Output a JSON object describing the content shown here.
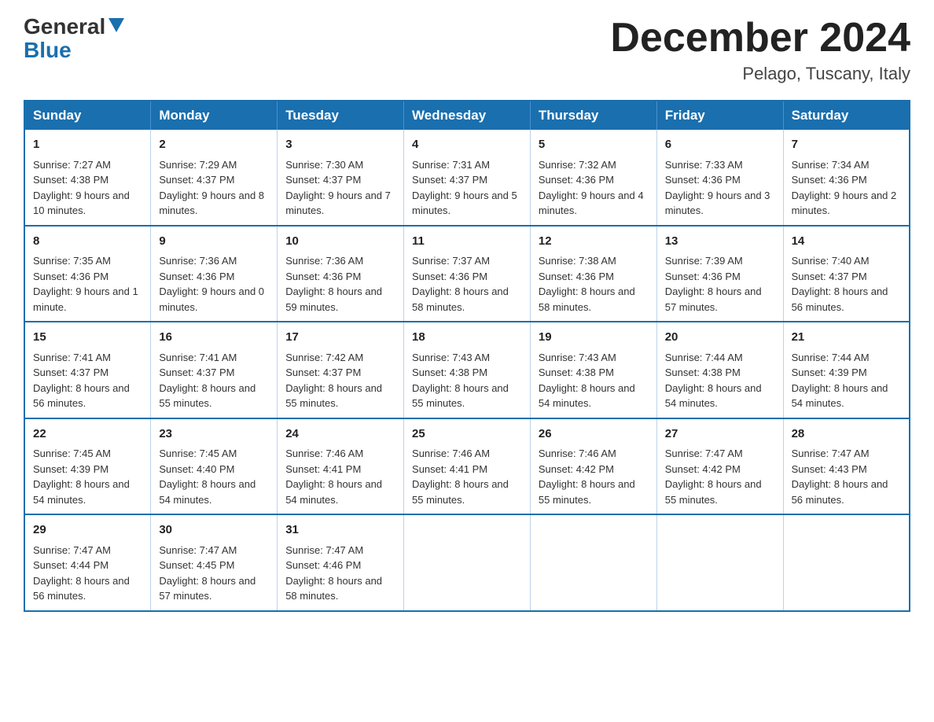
{
  "header": {
    "logo_line1": "General",
    "logo_line2": "Blue",
    "month": "December 2024",
    "location": "Pelago, Tuscany, Italy"
  },
  "days_of_week": [
    "Sunday",
    "Monday",
    "Tuesday",
    "Wednesday",
    "Thursday",
    "Friday",
    "Saturday"
  ],
  "weeks": [
    [
      {
        "day": "1",
        "sunrise": "7:27 AM",
        "sunset": "4:38 PM",
        "daylight": "9 hours and 10 minutes."
      },
      {
        "day": "2",
        "sunrise": "7:29 AM",
        "sunset": "4:37 PM",
        "daylight": "9 hours and 8 minutes."
      },
      {
        "day": "3",
        "sunrise": "7:30 AM",
        "sunset": "4:37 PM",
        "daylight": "9 hours and 7 minutes."
      },
      {
        "day": "4",
        "sunrise": "7:31 AM",
        "sunset": "4:37 PM",
        "daylight": "9 hours and 5 minutes."
      },
      {
        "day": "5",
        "sunrise": "7:32 AM",
        "sunset": "4:36 PM",
        "daylight": "9 hours and 4 minutes."
      },
      {
        "day": "6",
        "sunrise": "7:33 AM",
        "sunset": "4:36 PM",
        "daylight": "9 hours and 3 minutes."
      },
      {
        "day": "7",
        "sunrise": "7:34 AM",
        "sunset": "4:36 PM",
        "daylight": "9 hours and 2 minutes."
      }
    ],
    [
      {
        "day": "8",
        "sunrise": "7:35 AM",
        "sunset": "4:36 PM",
        "daylight": "9 hours and 1 minute."
      },
      {
        "day": "9",
        "sunrise": "7:36 AM",
        "sunset": "4:36 PM",
        "daylight": "9 hours and 0 minutes."
      },
      {
        "day": "10",
        "sunrise": "7:36 AM",
        "sunset": "4:36 PM",
        "daylight": "8 hours and 59 minutes."
      },
      {
        "day": "11",
        "sunrise": "7:37 AM",
        "sunset": "4:36 PM",
        "daylight": "8 hours and 58 minutes."
      },
      {
        "day": "12",
        "sunrise": "7:38 AM",
        "sunset": "4:36 PM",
        "daylight": "8 hours and 58 minutes."
      },
      {
        "day": "13",
        "sunrise": "7:39 AM",
        "sunset": "4:36 PM",
        "daylight": "8 hours and 57 minutes."
      },
      {
        "day": "14",
        "sunrise": "7:40 AM",
        "sunset": "4:37 PM",
        "daylight": "8 hours and 56 minutes."
      }
    ],
    [
      {
        "day": "15",
        "sunrise": "7:41 AM",
        "sunset": "4:37 PM",
        "daylight": "8 hours and 56 minutes."
      },
      {
        "day": "16",
        "sunrise": "7:41 AM",
        "sunset": "4:37 PM",
        "daylight": "8 hours and 55 minutes."
      },
      {
        "day": "17",
        "sunrise": "7:42 AM",
        "sunset": "4:37 PM",
        "daylight": "8 hours and 55 minutes."
      },
      {
        "day": "18",
        "sunrise": "7:43 AM",
        "sunset": "4:38 PM",
        "daylight": "8 hours and 55 minutes."
      },
      {
        "day": "19",
        "sunrise": "7:43 AM",
        "sunset": "4:38 PM",
        "daylight": "8 hours and 54 minutes."
      },
      {
        "day": "20",
        "sunrise": "7:44 AM",
        "sunset": "4:38 PM",
        "daylight": "8 hours and 54 minutes."
      },
      {
        "day": "21",
        "sunrise": "7:44 AM",
        "sunset": "4:39 PM",
        "daylight": "8 hours and 54 minutes."
      }
    ],
    [
      {
        "day": "22",
        "sunrise": "7:45 AM",
        "sunset": "4:39 PM",
        "daylight": "8 hours and 54 minutes."
      },
      {
        "day": "23",
        "sunrise": "7:45 AM",
        "sunset": "4:40 PM",
        "daylight": "8 hours and 54 minutes."
      },
      {
        "day": "24",
        "sunrise": "7:46 AM",
        "sunset": "4:41 PM",
        "daylight": "8 hours and 54 minutes."
      },
      {
        "day": "25",
        "sunrise": "7:46 AM",
        "sunset": "4:41 PM",
        "daylight": "8 hours and 55 minutes."
      },
      {
        "day": "26",
        "sunrise": "7:46 AM",
        "sunset": "4:42 PM",
        "daylight": "8 hours and 55 minutes."
      },
      {
        "day": "27",
        "sunrise": "7:47 AM",
        "sunset": "4:42 PM",
        "daylight": "8 hours and 55 minutes."
      },
      {
        "day": "28",
        "sunrise": "7:47 AM",
        "sunset": "4:43 PM",
        "daylight": "8 hours and 56 minutes."
      }
    ],
    [
      {
        "day": "29",
        "sunrise": "7:47 AM",
        "sunset": "4:44 PM",
        "daylight": "8 hours and 56 minutes."
      },
      {
        "day": "30",
        "sunrise": "7:47 AM",
        "sunset": "4:45 PM",
        "daylight": "8 hours and 57 minutes."
      },
      {
        "day": "31",
        "sunrise": "7:47 AM",
        "sunset": "4:46 PM",
        "daylight": "8 hours and 58 minutes."
      },
      null,
      null,
      null,
      null
    ]
  ]
}
